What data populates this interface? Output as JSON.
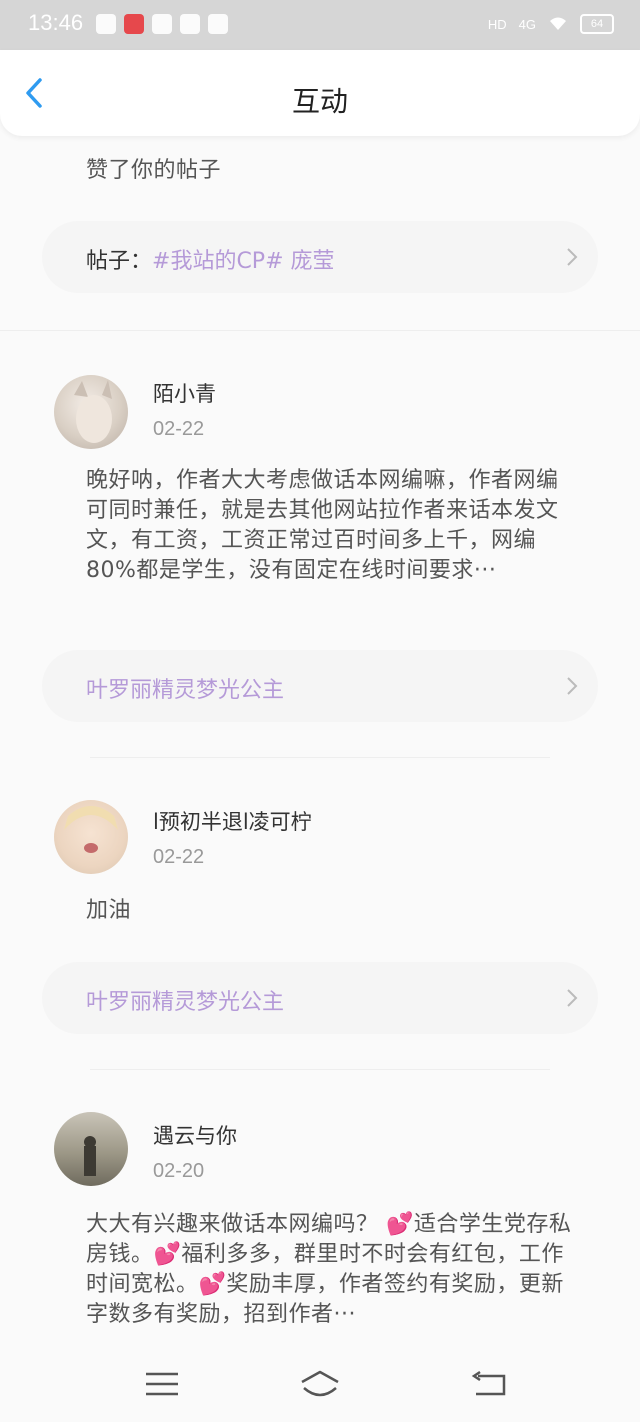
{
  "status": {
    "time": "13:46",
    "network": "4G",
    "battery": "64",
    "hd": "HD"
  },
  "header": {
    "title": "互动"
  },
  "items": [
    {
      "action": "赞了你的帖子",
      "card_prefix": "帖子：",
      "card_topic": "#我站的CP# 庞莹"
    },
    {
      "user": "陌小青",
      "date": "02-22",
      "text": "晚好呐，作者大大考虑做话本网编嘛，作者网编可同时兼任，就是去其他网站拉作者来话本发文文，有工资，工资正常过百时间多上千，网编80%都是学生，没有固定在线时间要求···",
      "card": "叶罗丽精灵梦光公主"
    },
    {
      "user": "l预初半退l凌可柠",
      "date": "02-22",
      "text": "加油",
      "card": "叶罗丽精灵梦光公主"
    },
    {
      "user": "遇云与你",
      "date": "02-20",
      "text": "大大有兴趣来做话本网编吗？ 💕适合学生党存私房钱。💕福利多多，群里时不时会有红包，工作时间宽松。💕奖励丰厚，作者签约有奖励，更新字数多有奖励，招到作者···"
    }
  ],
  "colors": {
    "accent": "#2f9bf0",
    "topic": "#b59ad8"
  }
}
